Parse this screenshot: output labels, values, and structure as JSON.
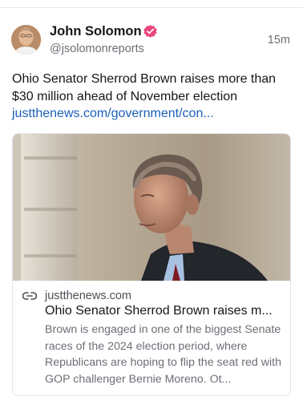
{
  "post": {
    "author": {
      "display_name": "John Solomon",
      "handle": "@jsolomonreports",
      "verified_badge_color": "#e8467c",
      "avatar_icon": "author-avatar"
    },
    "timestamp": "15m",
    "text": "Ohio Senator Sherrod Brown raises more than $30 million ahead of November election",
    "link_text": "justthenews.com/government/con...",
    "link_color": "#1a60b8"
  },
  "card": {
    "image_icon": "sherrod-brown-photo",
    "domain_icon": "link-icon",
    "domain": "justthenews.com",
    "title": "Ohio Senator Sherrod Brown raises m...",
    "description": "Brown is engaged in one of the biggest Senate races of the 2024 election period, where Republicans are hoping to flip the seat red with GOP challenger Bernie Moreno. Ot..."
  }
}
